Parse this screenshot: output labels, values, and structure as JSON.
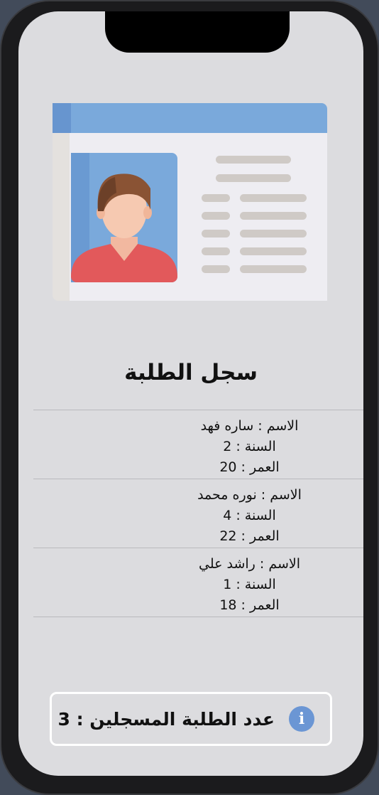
{
  "page": {
    "title": "سجل الطلبة"
  },
  "students": [
    {
      "name": "الاسم : ساره فهد",
      "year": "السنة : 2",
      "age": "العمر : 20"
    },
    {
      "name": "الاسم : نوره محمد",
      "year": "السنة : 4",
      "age": "العمر : 22"
    },
    {
      "name": "الاسم : راشد علي",
      "year": "السنة : 1",
      "age": "العمر : 18"
    }
  ],
  "footer": {
    "count_label": "عدد الطلبة المسجلين : 3",
    "icon": "info-icon"
  },
  "colors": {
    "background": "#dcdcdf",
    "accent": "#6b96d4",
    "card_header": "#7aa9db"
  }
}
